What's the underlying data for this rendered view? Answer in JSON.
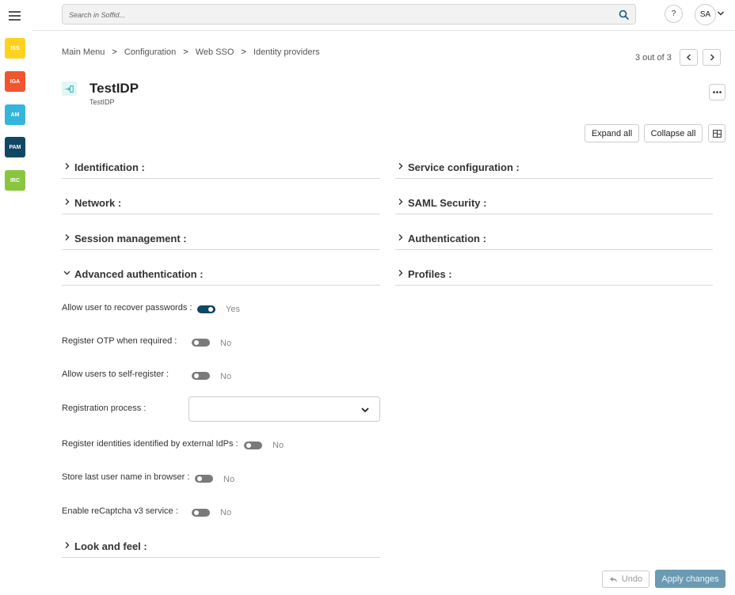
{
  "rail": {
    "apps": [
      {
        "label": "ISS",
        "bg": "#ffd21f",
        "fg": "#ffffff"
      },
      {
        "label": "IGA",
        "bg": "#f0552e",
        "fg": "#ffffff"
      },
      {
        "label": "AM",
        "bg": "#35b5dc",
        "fg": "#ffffff"
      },
      {
        "label": "PAM",
        "bg": "#0f4765",
        "fg": "#ffffff"
      },
      {
        "label": "IRC",
        "bg": "#8bc540",
        "fg": "#ffffff"
      }
    ]
  },
  "topbar": {
    "search_placeholder": "Search in Soffid...",
    "help_label": "?",
    "user_initials": "SA"
  },
  "breadcrumb": {
    "items": [
      "Main Menu",
      "Configuration",
      "Web SSO",
      "Identity providers"
    ],
    "separator": ">"
  },
  "pager": {
    "text": "3 out of 3"
  },
  "header": {
    "title": "TestIDP",
    "subtitle": "TestIDP"
  },
  "toolbar": {
    "expand_all": "Expand all",
    "collapse_all": "Collapse all"
  },
  "sections_left": [
    {
      "label": "Identification :",
      "expanded": false
    },
    {
      "label": "Network :",
      "expanded": false
    },
    {
      "label": "Session management :",
      "expanded": false
    },
    {
      "label": "Advanced authentication :",
      "expanded": true
    }
  ],
  "sections_right": [
    {
      "label": "Service configuration :",
      "expanded": false
    },
    {
      "label": "SAML Security :",
      "expanded": false
    },
    {
      "label": "Authentication :",
      "expanded": false
    },
    {
      "label": "Profiles :",
      "expanded": false
    }
  ],
  "advanced_auth": {
    "fields": [
      {
        "label": "Allow user to recover passwords :",
        "type": "toggle",
        "value": true,
        "value_text": "Yes"
      },
      {
        "label": "Register OTP when required :",
        "type": "toggle",
        "value": false,
        "value_text": "No"
      },
      {
        "label": "Allow users to self-register :",
        "type": "toggle",
        "value": false,
        "value_text": "No"
      },
      {
        "label": "Registration process :",
        "type": "select",
        "value": ""
      },
      {
        "label": "Register identities identified by external IdPs :",
        "type": "toggle",
        "value": false,
        "value_text": "No"
      },
      {
        "label": "Store last user name in browser :",
        "type": "toggle",
        "value": false,
        "value_text": "No"
      },
      {
        "label": "Enable reCaptcha v3 service :",
        "type": "toggle",
        "value": false,
        "value_text": "No"
      }
    ]
  },
  "look_and_feel": {
    "label": "Look and feel :",
    "expanded": false
  },
  "footer": {
    "undo": "Undo",
    "apply": "Apply changes"
  }
}
